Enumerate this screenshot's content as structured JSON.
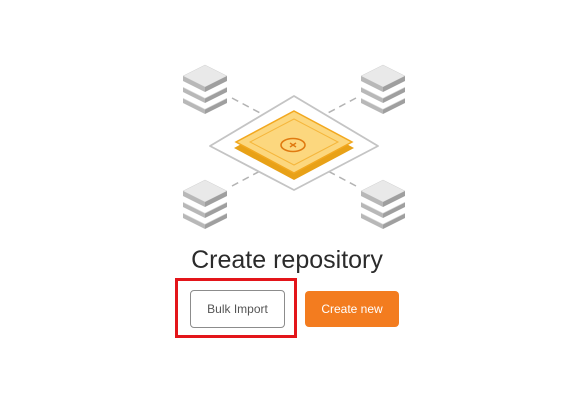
{
  "main": {
    "title": "Create repository",
    "buttons": {
      "bulk_import_label": "Bulk Import",
      "create_new_label": "Create new"
    }
  },
  "illustration": {
    "center_icon": "close-icon",
    "node_icon": "database-stack-icon"
  },
  "colors": {
    "accent": "#f37c1f",
    "tile_fill": "#fcd77e",
    "tile_border": "#f2a81f",
    "highlight": "#e3151a"
  }
}
